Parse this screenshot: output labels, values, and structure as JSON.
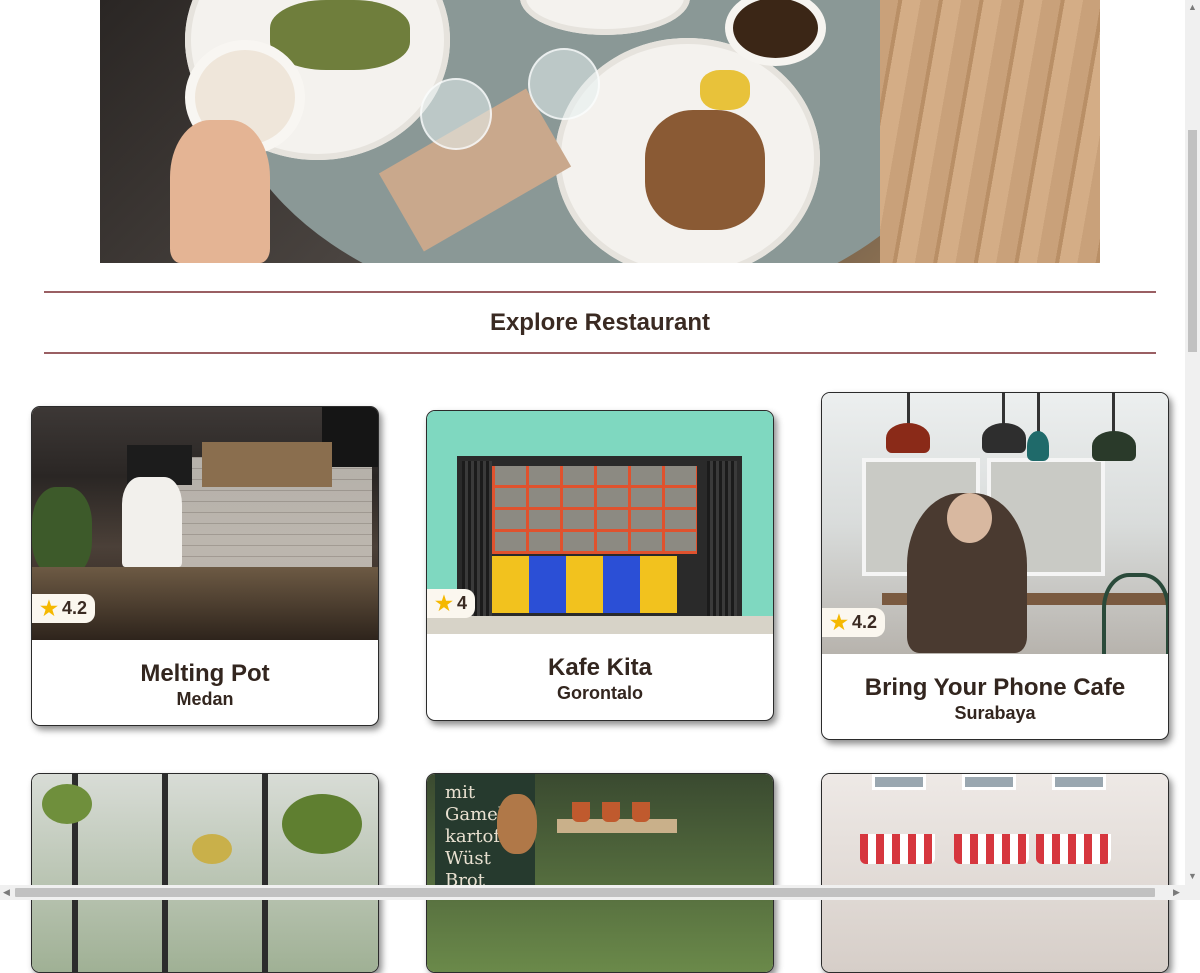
{
  "hero": {
    "image": "breakfast-table-photo"
  },
  "section": {
    "title": "Explore Restaurant"
  },
  "restaurants": [
    {
      "name": "Melting Pot",
      "city": "Medan",
      "rating": "4.2"
    },
    {
      "name": "Kafe Kita",
      "city": "Gorontalo",
      "rating": "4"
    },
    {
      "name": "Bring Your Phone Cafe",
      "city": "Surabaya",
      "rating": "4.2"
    },
    {
      "name": "",
      "city": "",
      "rating": ""
    },
    {
      "name": "",
      "city": "",
      "rating": ""
    },
    {
      "name": "",
      "city": "",
      "rating": ""
    }
  ],
  "chalkboard": {
    "text": "mit Gamelen kartoffeln Wüst Brot"
  },
  "icons": {
    "rating": "star-icon"
  },
  "colors": {
    "divider": "#9a5f63",
    "star": "#f5b800",
    "text": "#33261f"
  }
}
